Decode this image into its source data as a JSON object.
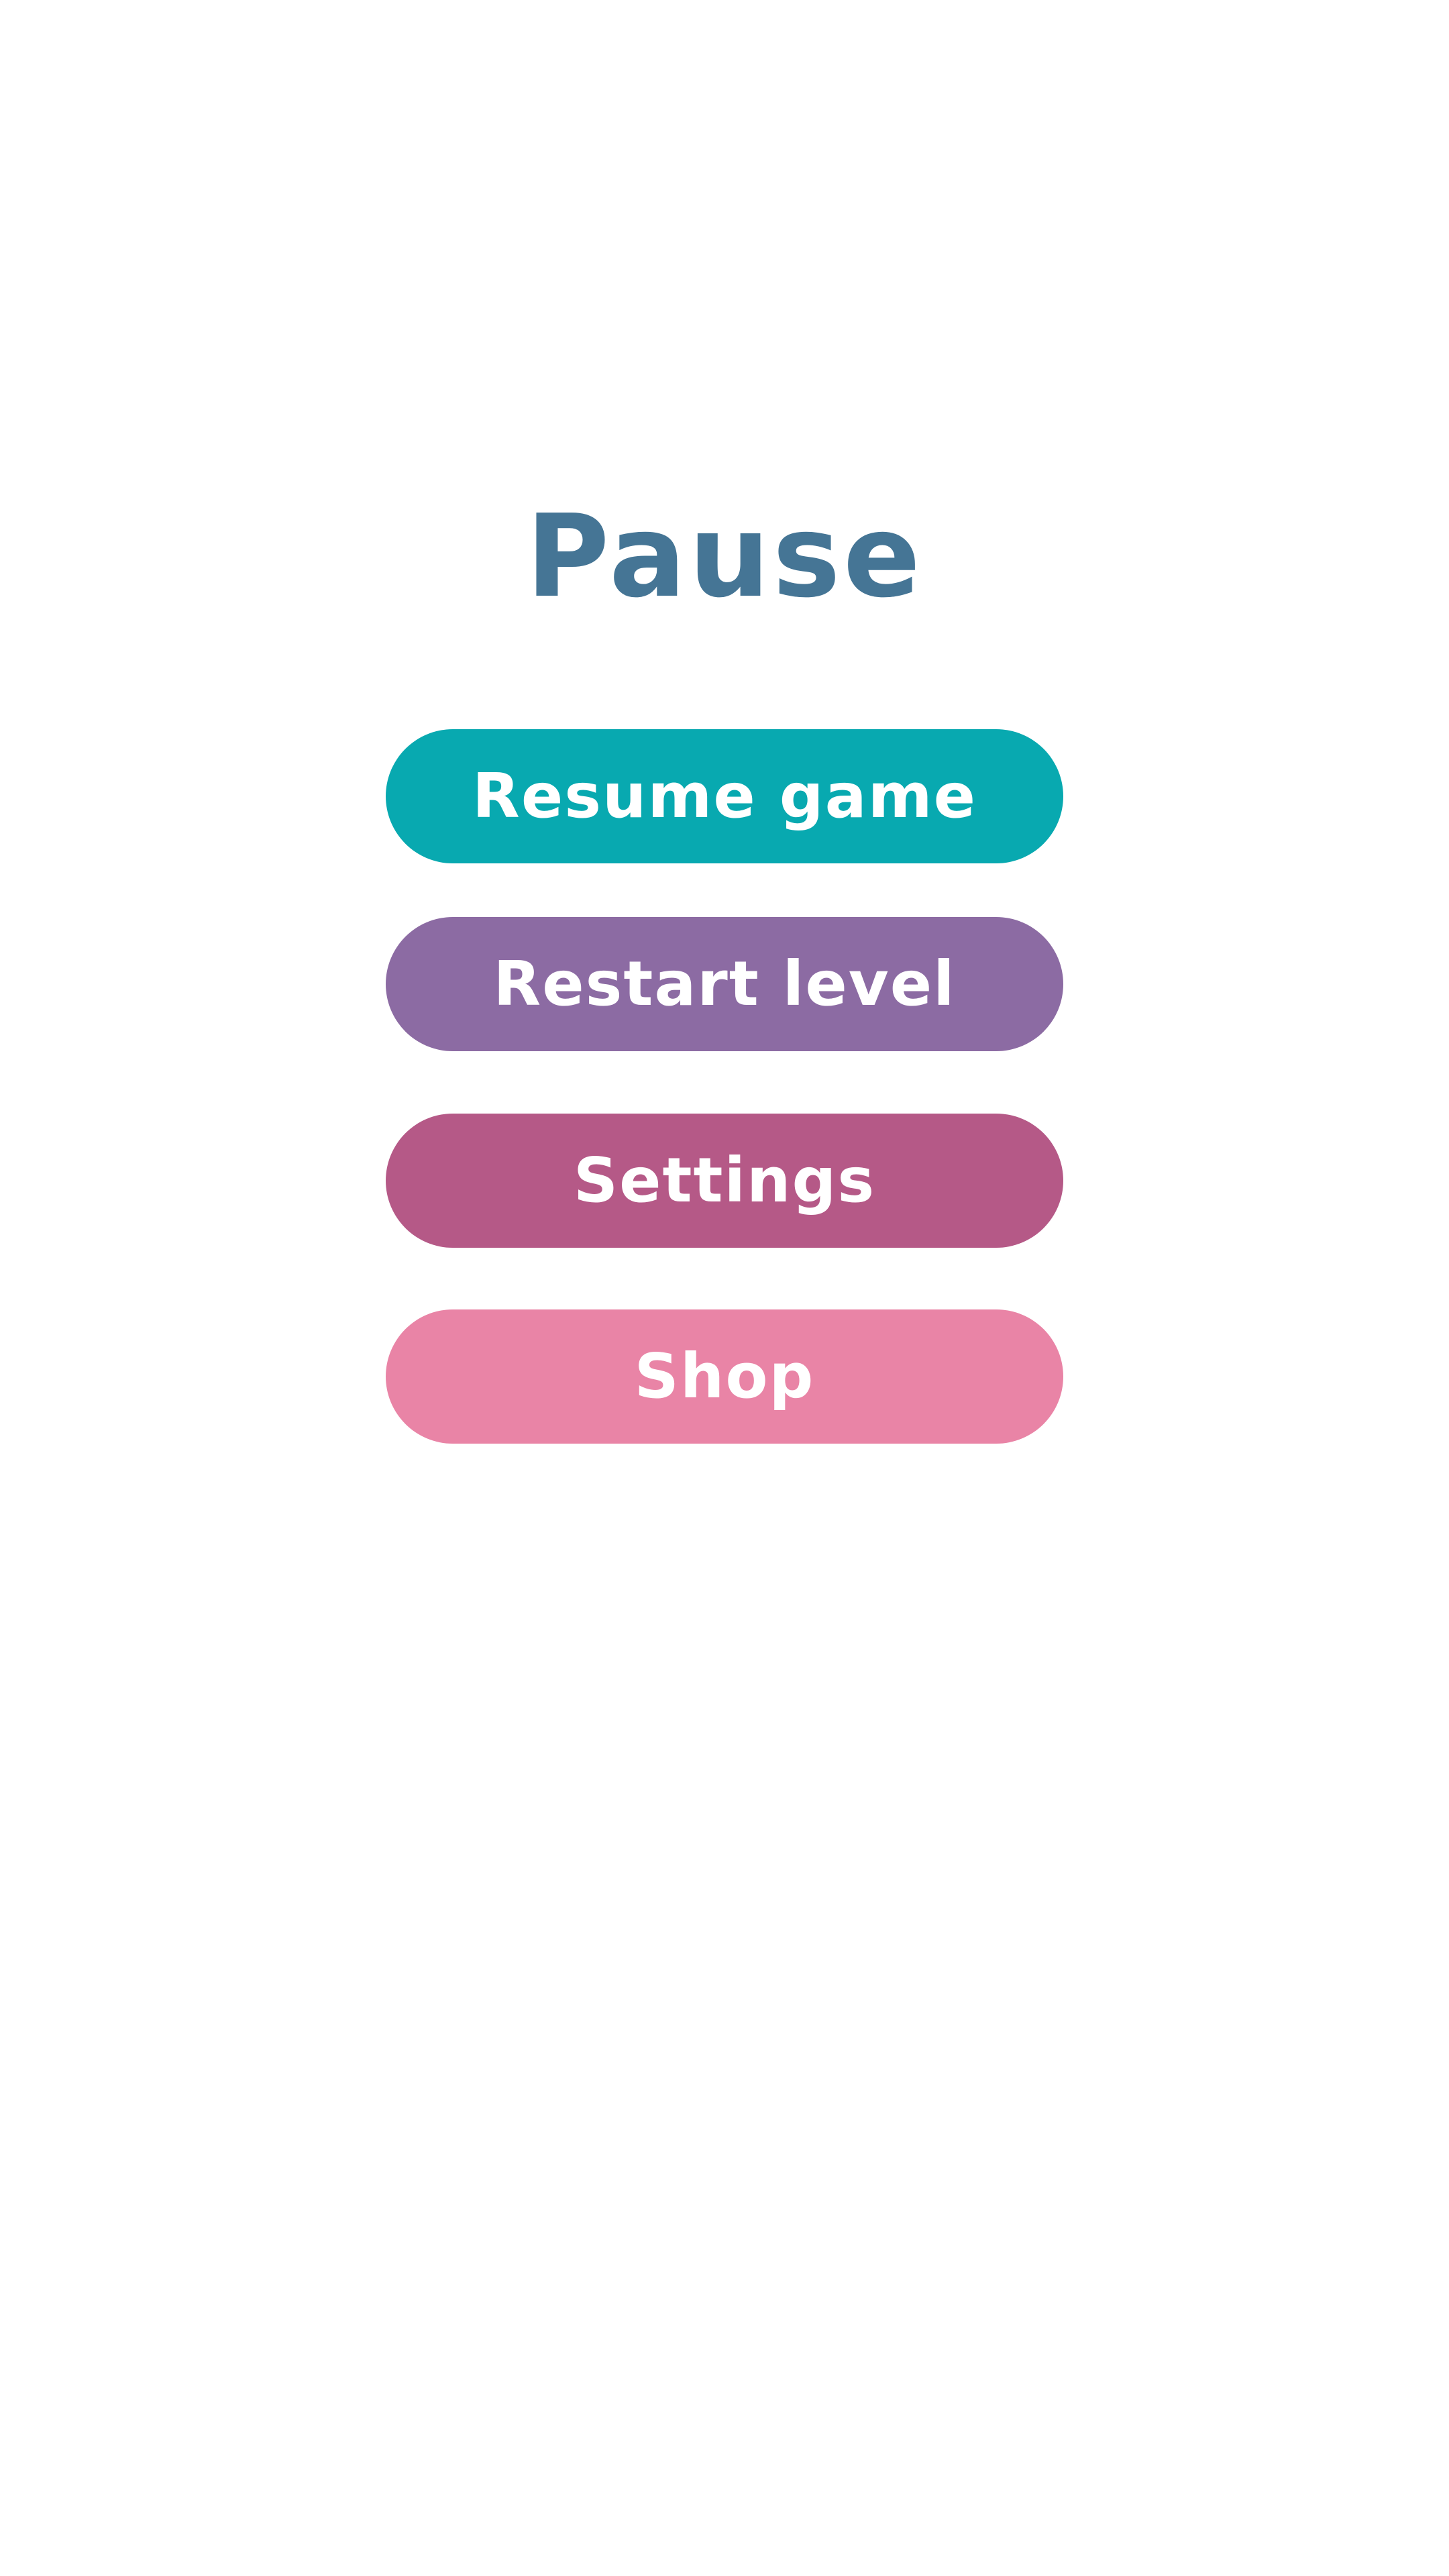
{
  "screen": {
    "title": "Pause",
    "title_color": "#457595",
    "background_color": "#ffffff"
  },
  "menu": {
    "items": [
      {
        "label": "Resume game",
        "color": "#08a9b0"
      },
      {
        "label": "Restart level",
        "color": "#8c6ba3"
      },
      {
        "label": "Settings",
        "color": "#b55987"
      },
      {
        "label": "Shop",
        "color": "#e984a6"
      }
    ],
    "label_color": "#ffffff"
  }
}
